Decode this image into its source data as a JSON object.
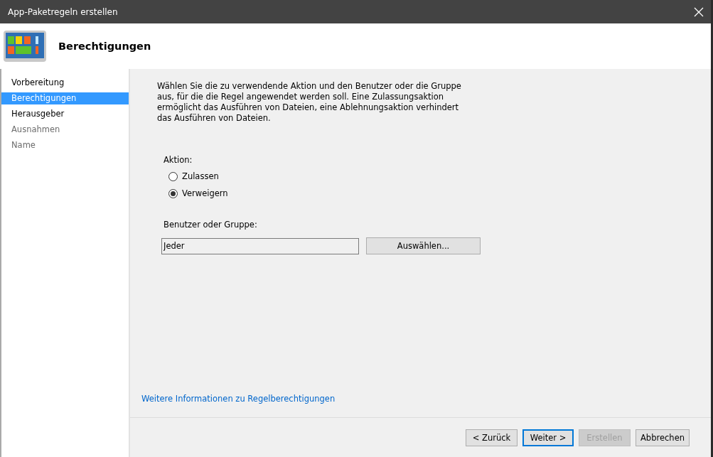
{
  "window": {
    "title": "App-Paketregeln erstellen"
  },
  "header": {
    "title": "Berechtigungen"
  },
  "steps": [
    {
      "label": "Vorbereitung",
      "selected": false,
      "disabled": false
    },
    {
      "label": "Berechtigungen",
      "selected": true,
      "disabled": false
    },
    {
      "label": "Herausgeber",
      "selected": false,
      "disabled": false
    },
    {
      "label": "Ausnahmen",
      "selected": false,
      "disabled": true
    },
    {
      "label": "Name",
      "selected": false,
      "disabled": true
    }
  ],
  "description": "Wählen Sie die zu verwendende Aktion und den Benutzer oder die Gruppe aus, für die die Regel angewendet werden soll. Eine Zulassungsaktion ermöglicht das Ausführen von Dateien, eine Ablehnungsaktion verhindert das Ausführen von Dateien.",
  "action": {
    "label": "Aktion:",
    "options": [
      {
        "label": "Zulassen",
        "selected": false
      },
      {
        "label": "Verweigern",
        "selected": true
      }
    ]
  },
  "user": {
    "label": "Benutzer oder Gruppe:",
    "value": "Jeder",
    "button": "Auswählen..."
  },
  "link": "Weitere Informationen zu Regelberechtigungen",
  "buttons": [
    {
      "label": "< Zurück",
      "disabled": false,
      "default": false
    },
    {
      "label": "Weiter >",
      "disabled": false,
      "default": true
    },
    {
      "label": "Erstellen",
      "disabled": true,
      "default": false
    },
    {
      "label": "Abbrechen",
      "disabled": false,
      "default": false
    }
  ]
}
